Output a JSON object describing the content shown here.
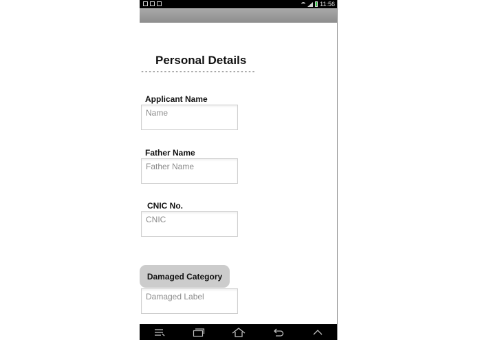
{
  "status_bar": {
    "time": "11:56",
    "notification_icons": [
      "file-icon",
      "image-icon",
      "mail-icon"
    ],
    "system_icons": [
      "wifi-icon",
      "signal-icon",
      "battery-icon"
    ]
  },
  "form": {
    "title": "Personal Details",
    "divider": "------------------------------",
    "applicant_name": {
      "label": "Applicant Name",
      "placeholder": "Name"
    },
    "father_name": {
      "label": "Father Name",
      "placeholder": "Father Name"
    },
    "cnic": {
      "label": "CNIC No.",
      "placeholder": "CNIC"
    },
    "damaged_category": {
      "button_label": "Damaged Category",
      "placeholder": "Damaged Label"
    }
  },
  "nav_bar": {
    "buttons": [
      "menu-icon",
      "recent-apps-icon",
      "home-icon",
      "back-icon",
      "up-arrow-icon"
    ]
  },
  "colors": {
    "status_bar": "#000000",
    "action_bar": "#9c9c9c",
    "button": "#cccccc",
    "text": "#111111",
    "placeholder": "#8a8a8a"
  }
}
